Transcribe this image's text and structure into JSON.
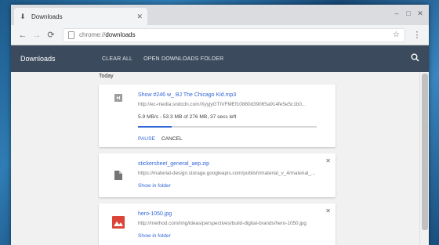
{
  "tab": {
    "title": "Downloads",
    "download_icon": "download-icon"
  },
  "window": {
    "minimize": "–",
    "maximize": "□",
    "close": "✕"
  },
  "toolbar": {
    "back": "←",
    "forward": "→",
    "reload": "⟳",
    "url_scheme": "chrome://",
    "url_host": "downloads",
    "star": "☆",
    "menu": "⋮"
  },
  "appbar": {
    "title": "Downloads",
    "clear_all": "CLEAR ALL",
    "open_folder": "OPEN DOWNLOADS FOLDER",
    "search_icon": "🔍"
  },
  "section": {
    "title": "Today"
  },
  "downloads": [
    {
      "file_name": "Show #246 w_ BJ The Chicago Kid.mp3",
      "url": "http://ec-media.sndcdn.com/XyyjyGTIVFMEf10880d39065a914fe5e5c1b0...",
      "status": "5.9 MB/s - 53.3 MB of 276 MB, 37 secs left",
      "progress": 0.19,
      "pause_label": "PAUSE",
      "cancel_label": "CANCEL",
      "icon": "audio-file-icon"
    },
    {
      "file_name": "stickersheet_general_aep.zip",
      "url": "https://material-design.storage.googleapis.com/publish/material_v_4/material_...",
      "show_in_folder": "Show in folder",
      "close": "✕",
      "icon": "file-icon"
    },
    {
      "file_name": "hero-1050.jpg",
      "url": "http://method.com/img/ideas/perspectives/build-digital-brands/hero-1050.jpg",
      "show_in_folder": "Show in folder",
      "close": "✕",
      "icon": "image-file-icon",
      "icon_color": "#db4437"
    }
  ]
}
